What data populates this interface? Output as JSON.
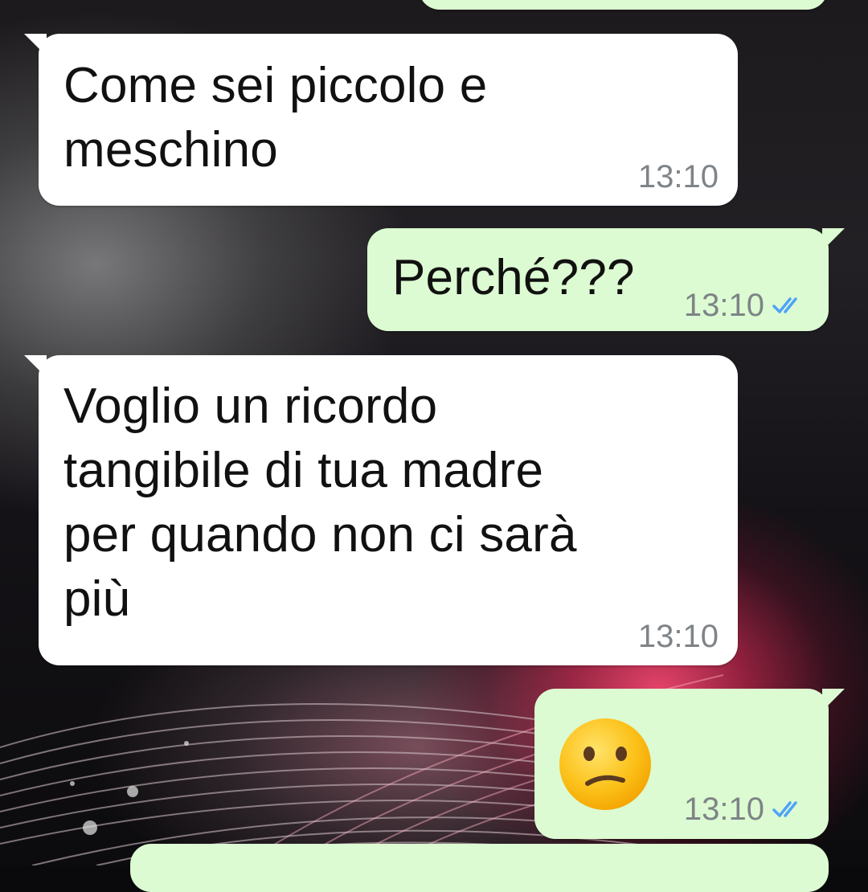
{
  "messages": [
    {
      "direction": "incoming",
      "text": "Come sei piccolo e\nmeschino",
      "time": "13:10"
    },
    {
      "direction": "outgoing",
      "text": "Perché???",
      "time": "13:10",
      "status": "read",
      "status_icon": "double-check-icon"
    },
    {
      "direction": "incoming",
      "text": "Voglio un ricordo\ntangibile di tua madre\nper quando non ci sarà\npiù",
      "time": "13:10"
    },
    {
      "direction": "outgoing",
      "emoji": "confused-face-emoji",
      "time": "13:10",
      "status": "read",
      "status_icon": "double-check-icon"
    }
  ],
  "colors": {
    "incoming_bubble": "#ffffff",
    "outgoing_bubble": "#dcfbd2",
    "timestamp": "#7e8487",
    "read_ticks": "#4fa3f7"
  }
}
